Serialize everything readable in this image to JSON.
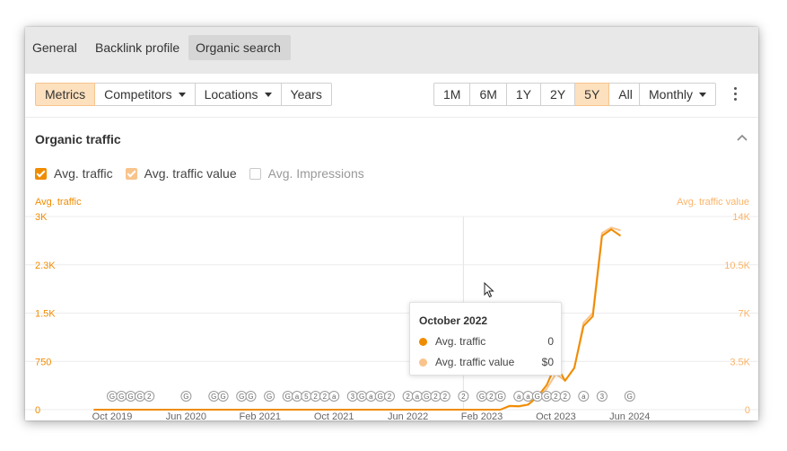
{
  "tabs": [
    {
      "label": "General"
    },
    {
      "label": "Backlink profile"
    },
    {
      "label": "Organic search"
    }
  ],
  "toolbar": {
    "left": [
      "Metrics",
      "Competitors",
      "Locations",
      "Years"
    ],
    "ranges": [
      "1M",
      "6M",
      "1Y",
      "2Y",
      "5Y",
      "All"
    ],
    "interval": "Monthly"
  },
  "section": {
    "title": "Organic traffic"
  },
  "legend": [
    {
      "label": "Avg. traffic",
      "checked": true,
      "color": "#f08c00"
    },
    {
      "label": "Avg. traffic value",
      "checked": true,
      "color": "#f9c48c"
    },
    {
      "label": "Avg. Impressions",
      "checked": false,
      "color": "#cccccc"
    }
  ],
  "tooltip": {
    "title": "October 2022",
    "rows": [
      {
        "label": "Avg. traffic",
        "value": "0",
        "color": "#f08c00"
      },
      {
        "label": "Avg. traffic value",
        "value": "$0",
        "color": "#f9c48c"
      }
    ]
  },
  "chart_data": {
    "type": "line",
    "left_axis_title": "Avg. traffic",
    "right_axis_title": "Avg. traffic value",
    "y_left_ticks": [
      "0",
      "750",
      "1.5K",
      "2.3K",
      "3K"
    ],
    "y_right_ticks": [
      "0",
      "3.5K",
      "7K",
      "10.5K",
      "14K"
    ],
    "ylim_left": [
      0,
      3000
    ],
    "ylim_right": [
      0,
      14000
    ],
    "x_tick_labels": [
      "Oct 2019",
      "Jun 2020",
      "Feb 2021",
      "Oct 2021",
      "Jun 2022",
      "Feb 2023",
      "Oct 2023",
      "Jun 2024"
    ],
    "x_tick_months": [
      0,
      8,
      16,
      24,
      32,
      40,
      48,
      56
    ],
    "start_month": "Aug 2019",
    "end_month": "Jul 2024",
    "hover_month": 38,
    "series": [
      {
        "name": "Avg. traffic",
        "color": "#f08c00",
        "axis": "left",
        "points": [
          [
            -2,
            0
          ],
          [
            40,
            0
          ],
          [
            42,
            0
          ],
          [
            43,
            60
          ],
          [
            44,
            55
          ],
          [
            45,
            80
          ],
          [
            46,
            200
          ],
          [
            47,
            380
          ],
          [
            48,
            700
          ],
          [
            49,
            450
          ],
          [
            50,
            650
          ],
          [
            51,
            1300
          ],
          [
            52,
            1450
          ],
          [
            53,
            2700
          ],
          [
            54,
            2800
          ],
          [
            55,
            2700
          ]
        ]
      },
      {
        "name": "Avg. traffic value",
        "color": "#f9c48c",
        "axis": "right",
        "points": [
          [
            -2,
            0
          ],
          [
            40,
            0
          ],
          [
            42,
            0
          ],
          [
            43,
            250
          ],
          [
            44,
            220
          ],
          [
            45,
            350
          ],
          [
            46,
            900
          ],
          [
            47,
            1500
          ],
          [
            48,
            2600
          ],
          [
            49,
            2100
          ],
          [
            50,
            3000
          ],
          [
            51,
            6300
          ],
          [
            52,
            7000
          ],
          [
            53,
            12800
          ],
          [
            54,
            13200
          ],
          [
            55,
            13000
          ]
        ]
      }
    ],
    "annotation_markers": [
      {
        "month": 0,
        "label": "G"
      },
      {
        "month": 1,
        "label": "G"
      },
      {
        "month": 2,
        "label": "G"
      },
      {
        "month": 3,
        "label": "G"
      },
      {
        "month": 4,
        "label": "2"
      },
      {
        "month": 8,
        "label": "G"
      },
      {
        "month": 11,
        "label": "G"
      },
      {
        "month": 12,
        "label": "G"
      },
      {
        "month": 14,
        "label": "G"
      },
      {
        "month": 15,
        "label": "G"
      },
      {
        "month": 17,
        "label": "G"
      },
      {
        "month": 19,
        "label": "G"
      },
      {
        "month": 20,
        "label": "a"
      },
      {
        "month": 21,
        "label": "5"
      },
      {
        "month": 22,
        "label": "2"
      },
      {
        "month": 23,
        "label": "2"
      },
      {
        "month": 24,
        "label": "a"
      },
      {
        "month": 26,
        "label": "3"
      },
      {
        "month": 27,
        "label": "G"
      },
      {
        "month": 28,
        "label": "a"
      },
      {
        "month": 29,
        "label": "G"
      },
      {
        "month": 30,
        "label": "2"
      },
      {
        "month": 32,
        "label": "2"
      },
      {
        "month": 33,
        "label": "a"
      },
      {
        "month": 34,
        "label": "G"
      },
      {
        "month": 35,
        "label": "2"
      },
      {
        "month": 36,
        "label": "2"
      },
      {
        "month": 38,
        "label": "2"
      },
      {
        "month": 40,
        "label": "G"
      },
      {
        "month": 41,
        "label": "2"
      },
      {
        "month": 42,
        "label": "G"
      },
      {
        "month": 44,
        "label": "a"
      },
      {
        "month": 45,
        "label": "a"
      },
      {
        "month": 46,
        "label": "G"
      },
      {
        "month": 47,
        "label": "G"
      },
      {
        "month": 48,
        "label": "2"
      },
      {
        "month": 49,
        "label": "2"
      },
      {
        "month": 51,
        "label": "a"
      },
      {
        "month": 53,
        "label": "3"
      },
      {
        "month": 56,
        "label": "G"
      }
    ]
  }
}
